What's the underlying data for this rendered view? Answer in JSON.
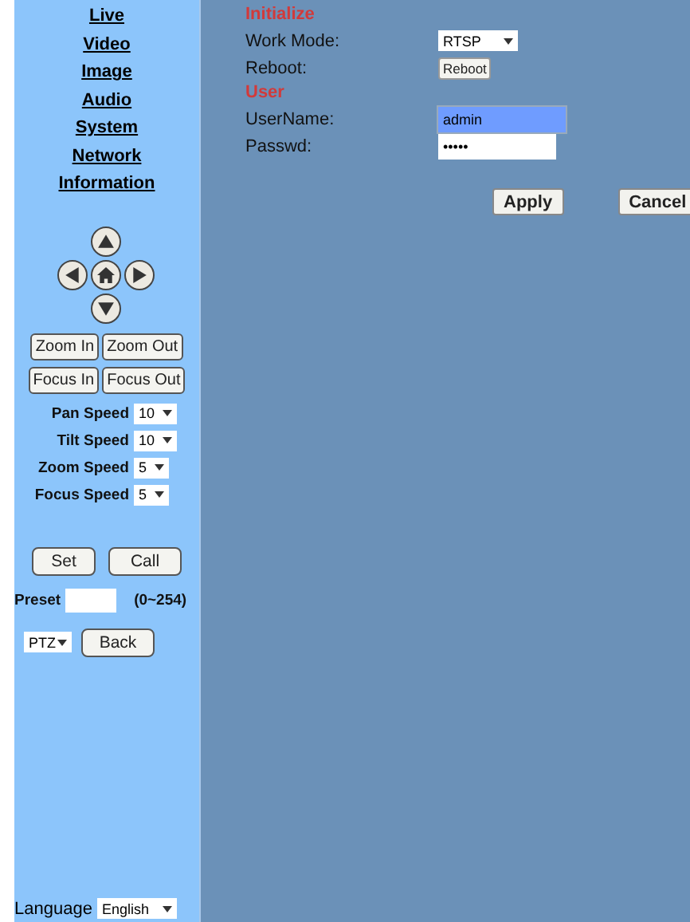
{
  "sidebar": {
    "nav": [
      {
        "label": "Live"
      },
      {
        "label": "Video"
      },
      {
        "label": "Image"
      },
      {
        "label": "Audio"
      },
      {
        "label": "System"
      },
      {
        "label": "Network"
      },
      {
        "label": "Information"
      }
    ],
    "ptz_buttons": [
      [
        "Zoom In",
        "Zoom Out"
      ],
      [
        "Focus In",
        "Focus Out"
      ]
    ],
    "speeds": [
      {
        "label": "Pan Speed",
        "value": "10"
      },
      {
        "label": "Tilt Speed",
        "value": "10"
      },
      {
        "label": "Zoom Speed",
        "value": "5"
      },
      {
        "label": "Focus Speed",
        "value": "5"
      }
    ],
    "preset_buttons": [
      "Set",
      "Call"
    ],
    "preset": {
      "label": "Preset",
      "range": "(0~254)"
    },
    "mode": {
      "value": "PTZ",
      "button": "Back"
    },
    "language": {
      "label": "Language",
      "value": "English"
    }
  },
  "main": {
    "sections": [
      {
        "title": "Initialize",
        "rows": [
          {
            "kind": "select",
            "label": "Work Mode:",
            "value": "RTSP"
          },
          {
            "kind": "button",
            "label": "Reboot:",
            "value": "Reboot"
          }
        ]
      },
      {
        "title": "User",
        "rows": [
          {
            "kind": "input",
            "label": "UserName:",
            "value": "admin",
            "focused": true
          },
          {
            "kind": "input",
            "label": "Passwd:",
            "value": "•••••",
            "focused": false
          }
        ]
      }
    ],
    "buttons": [
      "Apply",
      "Cancel"
    ]
  }
}
